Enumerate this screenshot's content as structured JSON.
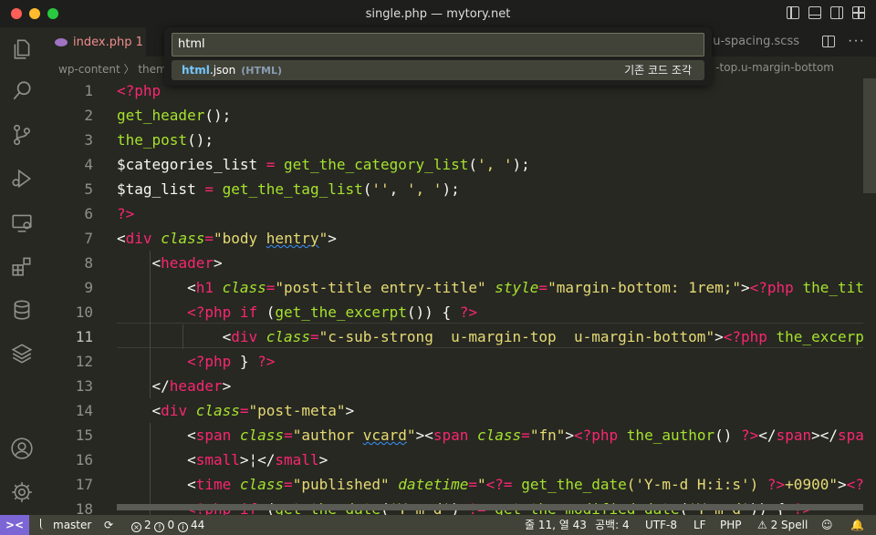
{
  "window": {
    "title": "single.php — mytory.net"
  },
  "tabs": {
    "active_label": "index.php 1",
    "right_label": "u-spacing.scss",
    "more_label": "···"
  },
  "breadcrumb": {
    "left": "wp-content  〉 them",
    "right": "-top.u-margin-bottom"
  },
  "quick_open": {
    "input_value": "html",
    "item": {
      "name_match": "html",
      "name_rest": ".json",
      "lang": "(HTML)",
      "description": "기존 코드 조각"
    }
  },
  "editor": {
    "current_line": 11,
    "lines": [
      {
        "n": "1"
      },
      {
        "n": "2"
      },
      {
        "n": "3"
      },
      {
        "n": "4"
      },
      {
        "n": "5"
      },
      {
        "n": "6"
      },
      {
        "n": "7"
      },
      {
        "n": "8"
      },
      {
        "n": "9"
      },
      {
        "n": "10"
      },
      {
        "n": "11"
      },
      {
        "n": "12"
      },
      {
        "n": "13"
      },
      {
        "n": "14"
      },
      {
        "n": "15"
      },
      {
        "n": "16"
      },
      {
        "n": "17"
      },
      {
        "n": "18"
      }
    ]
  },
  "statusbar": {
    "remote": "><",
    "branch": "master",
    "sync": "⟳",
    "errors": "2",
    "warnings": "0",
    "info": "44",
    "position": "줄 11, 열 43",
    "spaces": "공백: 4",
    "encoding": "UTF-8",
    "eol": "LF",
    "language": "PHP",
    "spell": "⚠ 2 Spell"
  },
  "colors": {
    "editor_bg": "#272822",
    "keyword": "#f92672",
    "function": "#a6e22e",
    "string": "#e6db74",
    "status_bg": "#414339",
    "remote_bg": "#7c65d4"
  },
  "icons": [
    "explorer-icon",
    "search-icon",
    "source-control-icon",
    "run-debug-icon",
    "remote-explorer-icon",
    "extensions-icon",
    "database-icon",
    "layers-icon",
    "account-icon",
    "settings-gear-icon"
  ]
}
